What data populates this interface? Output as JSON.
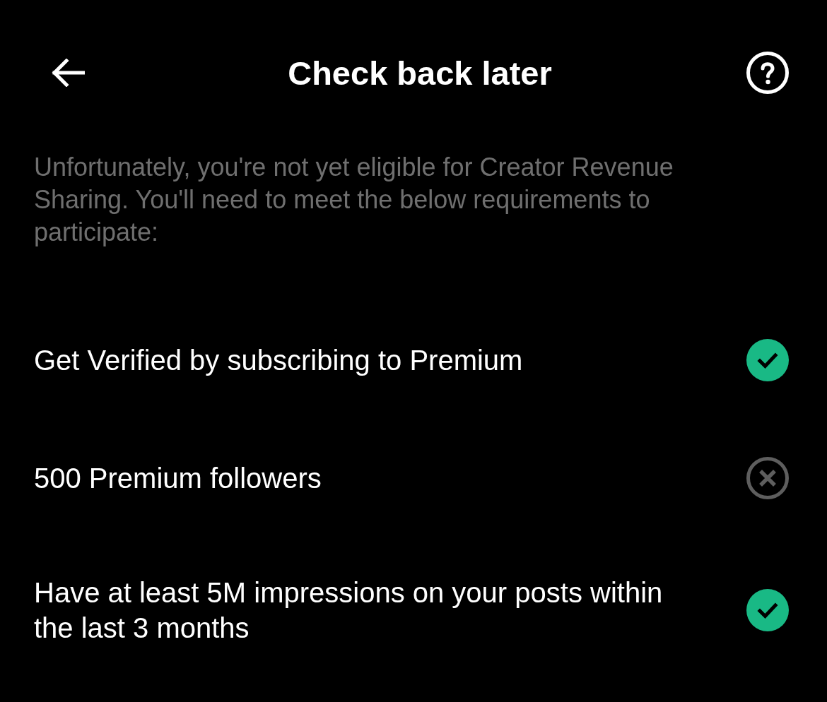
{
  "header": {
    "title": "Check back later"
  },
  "intro": "Unfortunately, you're not yet eligible for Creator Revenue Sharing. You'll need to meet the below requirements to participate:",
  "requirements": [
    {
      "text": "Get Verified by subscribing to Premium",
      "met": true
    },
    {
      "text": "500 Premium followers",
      "met": false
    },
    {
      "text": "Have at least 5M impressions on your posts within the last 3 months",
      "met": true
    }
  ]
}
